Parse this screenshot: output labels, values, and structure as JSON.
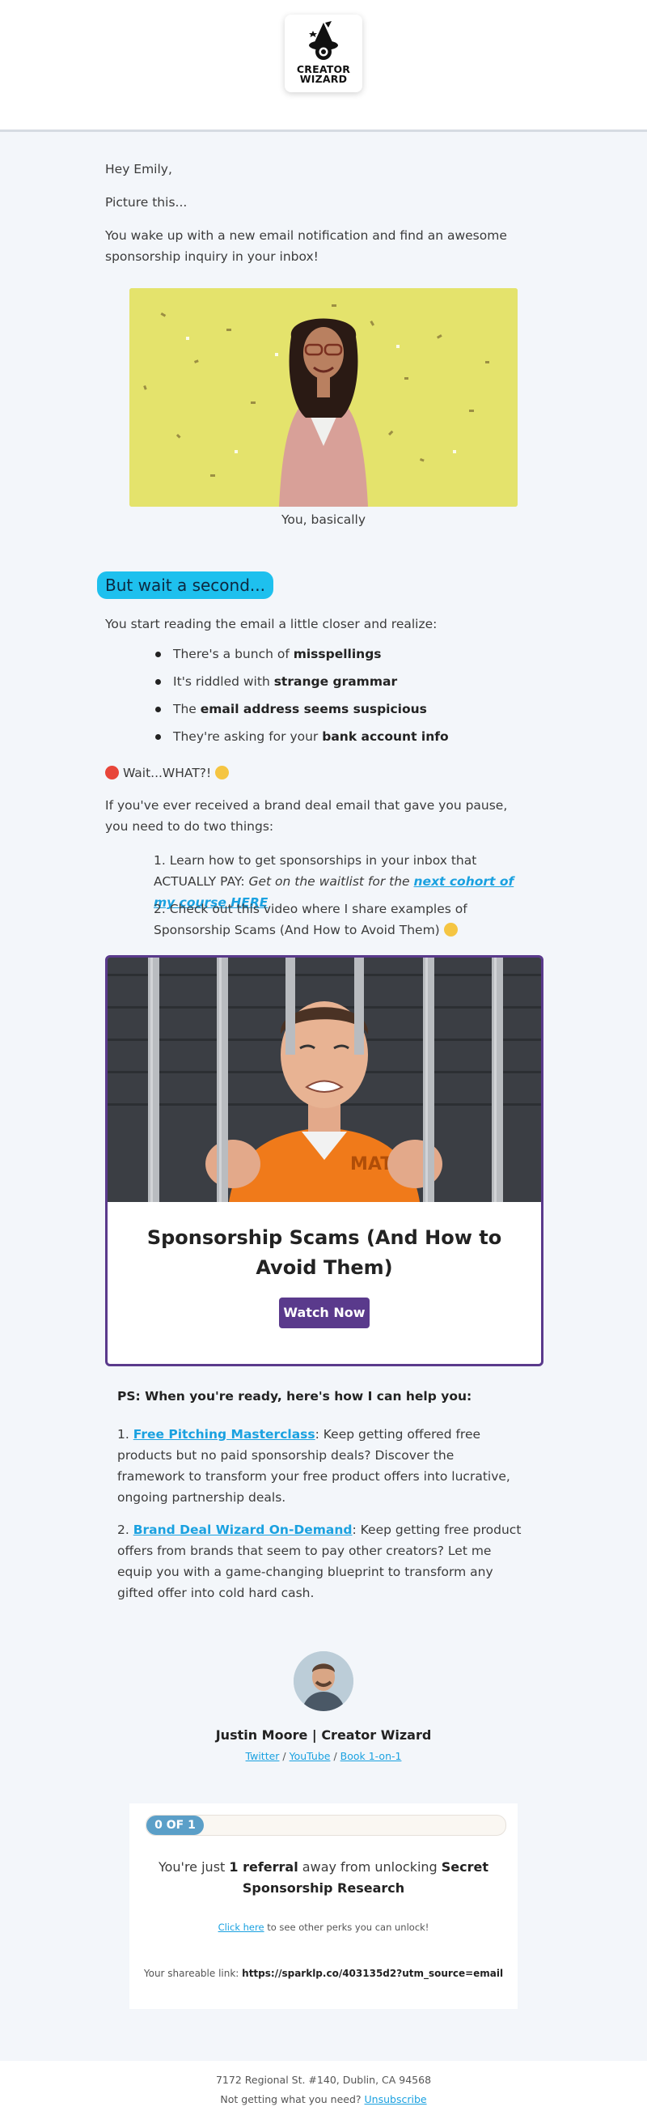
{
  "brand": {
    "logo_line1": "CREATOR",
    "logo_line2": "WIZARD",
    "accent": "#1ec0ee",
    "purple": "#5a3a8c"
  },
  "intro": {
    "greeting": "Hey Emily,",
    "line1": "Picture this...",
    "line2": "You wake up with a new email notification and find an awesome sponsorship inquiry in your inbox!",
    "image_caption": "You, basically"
  },
  "section": {
    "highlight": "But wait a second...",
    "lead": "You start reading the email a little closer and realize:",
    "bullets": [
      {
        "pre": "There's a bunch of ",
        "bold": "misspellings",
        "post": ""
      },
      {
        "pre": "It's riddled with ",
        "bold": "strange grammar",
        "post": ""
      },
      {
        "pre": "The ",
        "bold": "email address seems suspicious",
        "post": ""
      },
      {
        "pre": "They're asking for your ",
        "bold": "bank account info",
        "post": ""
      }
    ],
    "wait_text": "Wait...WHAT?!",
    "if_text": "If you've ever received a brand deal email that gave you pause, you need to do two things:",
    "step1_pre": "1. Learn how to get sponsorships in your inbox that ACTUALLY PAY: ",
    "step1_italic": "Get on the waitlist for the ",
    "step1_link": "next cohort of my course HERE",
    "step2": "2. Check out this video where I share examples of Sponsorship Scams (And How to Avoid Them)"
  },
  "video": {
    "thumb_shirt_text": "MATE",
    "title": "Sponsorship Scams (And How to Avoid Them)",
    "button": "Watch Now"
  },
  "ps": {
    "title": "PS: When you're ready, here's how I can help you:",
    "items": [
      {
        "num": "1. ",
        "link": "Free Pitching Masterclass",
        "text": ": Keep getting offered free products but no paid sponsorship deals? Discover the framework to transform your free product offers into lucrative, ongoing partnership deals."
      },
      {
        "num": "2. ",
        "link": "Brand Deal Wizard On-Demand",
        "text": ": Keep getting free product offers from brands that seem to pay other creators? Let me equip you with a game-changing blueprint to transform any gifted offer into cold hard cash."
      }
    ]
  },
  "signature": {
    "name": "Justin Moore | Creator Wizard",
    "links": [
      "Twitter",
      "YouTube",
      "Book 1-on-1"
    ],
    "sep": " / "
  },
  "referral": {
    "progress_label": "0 OF 1",
    "progress_fraction": 0.16,
    "main_pre": "You're just ",
    "main_bold1": "1 referral",
    "main_mid": " away from unlocking ",
    "main_bold2": "Secret Sponsorship Research",
    "perks_link": "Click here",
    "perks_text": " to see other perks you can unlock!",
    "share_label": "Your shareable link: ",
    "share_url": "https://sparklp.co/403135d2?utm_source=email"
  },
  "footer": {
    "address": "7172 Regional St. #140, Dublin, CA 94568",
    "question": "Not getting what you need? ",
    "unsubscribe": "Unsubscribe"
  }
}
